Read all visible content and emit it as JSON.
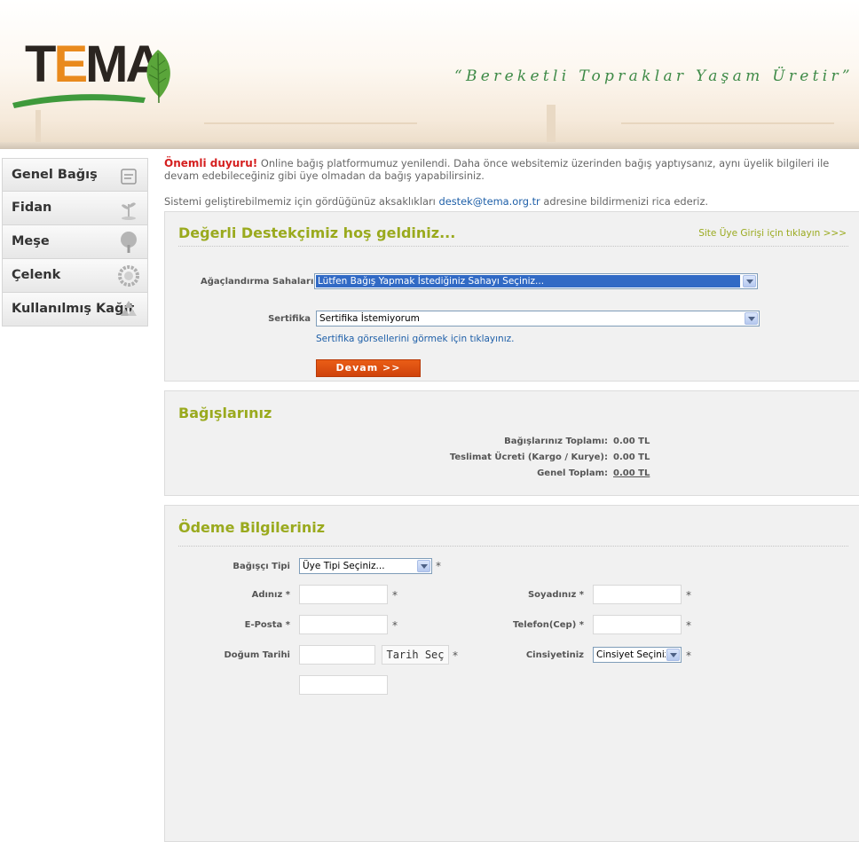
{
  "header": {
    "logo_text": "TEMA",
    "slogan": "“Bereketli Topraklar Yaşam Üretir”"
  },
  "sidebar": {
    "items": [
      {
        "label": "Genel Bağış",
        "icon": "hand-icon"
      },
      {
        "label": "Fidan",
        "icon": "sapling-icon"
      },
      {
        "label": "Meşe",
        "icon": "tree-icon"
      },
      {
        "label": "Çelenk",
        "icon": "wreath-icon"
      },
      {
        "label": "Kullanılmış Kağıt",
        "icon": "recycle-icon"
      }
    ]
  },
  "notice": {
    "label": "Önemli duyuru!",
    "text": " Online bağış platformumuz yenilendi. Daha önce websitemiz üzerinden bağış yaptıysanız, aynı üyelik bilgileri ile devam edebileceğiniz gibi üye olmadan da bağış yapabilirsiniz.",
    "line2_before": "Sistemi geliştirebilmemiz için gördüğünüz aksaklıkları ",
    "email": "destek@tema.org.tr",
    "line2_after": " adresine bildirmenizi rica ederiz."
  },
  "welcome": {
    "title": "Değerli Destekçimiz hoş geldiniz...",
    "member_login": "Site Üye Girişi için tıklayın >>>",
    "area_label": "Ağaçlandırma Sahaları",
    "area_value": "Lütfen Bağış Yapmak İstediğiniz Sahayı Seçiniz...",
    "cert_label": "Sertifika",
    "cert_value": "Sertifika İstemiyorum",
    "cert_link": "Sertifika görsellerini görmek için tıklayınız.",
    "continue_label": "Devam >>"
  },
  "donations": {
    "title": "Bağışlarınız",
    "rows": [
      {
        "label": "Bağışlarınız Toplamı:",
        "value": "0.00 TL"
      },
      {
        "label": "Teslimat Ücreti (Kargo / Kurye):",
        "value": "0.00 TL"
      },
      {
        "label": "Genel Toplam:",
        "value": "0.00 TL"
      }
    ]
  },
  "payment": {
    "title": "Ödeme Bilgileriniz",
    "donor_type_label": "Bağışçı Tipi",
    "donor_type_value": "Üye Tipi Seçiniz...",
    "first_name_label": "Adınız *",
    "last_name_label": "Soyadınız *",
    "email_label": "E-Posta *",
    "phone_label": "Telefon(Cep) *",
    "birth_label": "Doğum Tarihi",
    "date_button": "Tarih Seç",
    "gender_label": "Cinsiyetiniz",
    "gender_value": "Cinsiyet Seçiniz...",
    "required_mark": "*"
  },
  "colors": {
    "accent_green": "#9aaa1e",
    "alert_red": "#d51f1f",
    "button_orange": "#e0501a",
    "link_blue": "#1e5fa8",
    "slogan_green": "#3e8a47"
  }
}
